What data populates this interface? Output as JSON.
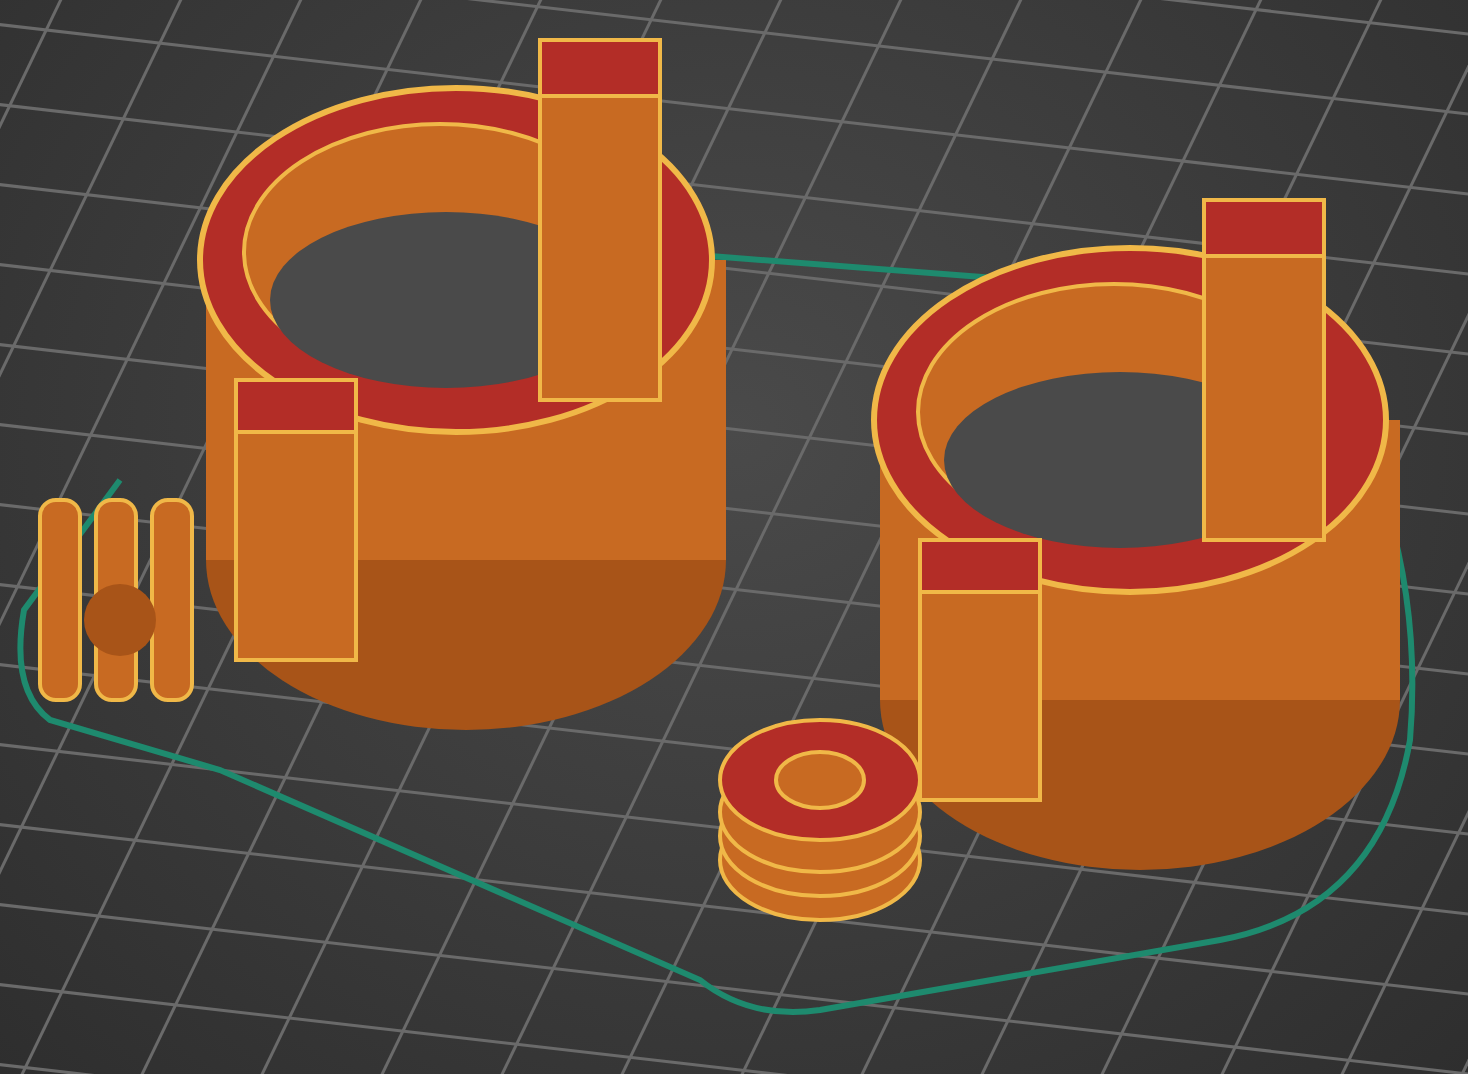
{
  "scene": {
    "kind": "slicer-preview"
  }
}
